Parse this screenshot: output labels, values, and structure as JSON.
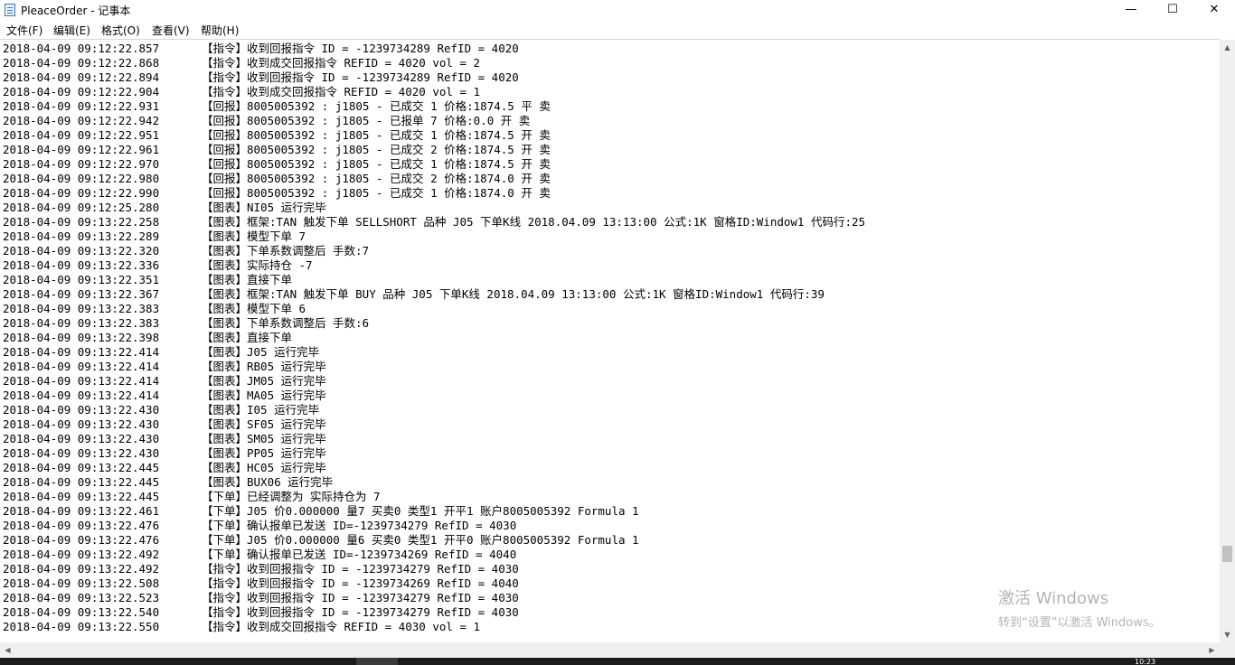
{
  "window": {
    "title": "PleaceOrder - 记事本"
  },
  "controls": {
    "minimize": "—",
    "maximize": "☐",
    "close": "✕"
  },
  "menu": [
    {
      "label": "文件(F)"
    },
    {
      "label": "编辑(E)"
    },
    {
      "label": "格式(O)"
    },
    {
      "label": "查看(V)"
    },
    {
      "label": "帮助(H)"
    }
  ],
  "lines": [
    {
      "ts": "2018-04-09 09:12:22.857",
      "msg": "【指令】收到回报指令 ID = -1239734289 RefID = 4020"
    },
    {
      "ts": "2018-04-09 09:12:22.868",
      "msg": "【指令】收到成交回报指令 REFID = 4020 vol = 2"
    },
    {
      "ts": "2018-04-09 09:12:22.894",
      "msg": "【指令】收到回报指令 ID = -1239734289 RefID = 4020"
    },
    {
      "ts": "2018-04-09 09:12:22.904",
      "msg": "【指令】收到成交回报指令 REFID = 4020 vol = 1"
    },
    {
      "ts": "2018-04-09 09:12:22.931",
      "msg": "【回报】8005005392 : j1805 - 已成交 1 价格:1874.5 平 卖"
    },
    {
      "ts": "2018-04-09 09:12:22.942",
      "msg": "【回报】8005005392 : j1805 - 已报单 7 价格:0.0 开 卖"
    },
    {
      "ts": "2018-04-09 09:12:22.951",
      "msg": "【回报】8005005392 : j1805 - 已成交 1 价格:1874.5 开 卖"
    },
    {
      "ts": "2018-04-09 09:12:22.961",
      "msg": "【回报】8005005392 : j1805 - 已成交 2 价格:1874.5 开 卖"
    },
    {
      "ts": "2018-04-09 09:12:22.970",
      "msg": "【回报】8005005392 : j1805 - 已成交 1 价格:1874.5 开 卖"
    },
    {
      "ts": "2018-04-09 09:12:22.980",
      "msg": "【回报】8005005392 : j1805 - 已成交 2 价格:1874.0 开 卖"
    },
    {
      "ts": "2018-04-09 09:12:22.990",
      "msg": "【回报】8005005392 : j1805 - 已成交 1 价格:1874.0 开 卖"
    },
    {
      "ts": "2018-04-09 09:12:25.280",
      "msg": "【图表】NI05 运行完毕"
    },
    {
      "ts": "2018-04-09 09:13:22.258",
      "msg": "【图表】框架:TAN 触发下单 SELLSHORT 品种 J05 下单K线 2018.04.09 13:13:00 公式:1K 窗格ID:Window1 代码行:25"
    },
    {
      "ts": "2018-04-09 09:13:22.289",
      "msg": "【图表】模型下单 7"
    },
    {
      "ts": "2018-04-09 09:13:22.320",
      "msg": "【图表】下单系数调整后 手数:7"
    },
    {
      "ts": "2018-04-09 09:13:22.336",
      "msg": "【图表】实际持仓 -7"
    },
    {
      "ts": "2018-04-09 09:13:22.351",
      "msg": "【图表】直接下单"
    },
    {
      "ts": "2018-04-09 09:13:22.367",
      "msg": "【图表】框架:TAN 触发下单 BUY 品种 J05 下单K线 2018.04.09 13:13:00 公式:1K 窗格ID:Window1 代码行:39"
    },
    {
      "ts": "2018-04-09 09:13:22.383",
      "msg": "【图表】模型下单 6"
    },
    {
      "ts": "2018-04-09 09:13:22.383",
      "msg": "【图表】下单系数调整后 手数:6"
    },
    {
      "ts": "2018-04-09 09:13:22.398",
      "msg": "【图表】直接下单"
    },
    {
      "ts": "2018-04-09 09:13:22.414",
      "msg": "【图表】J05 运行完毕"
    },
    {
      "ts": "2018-04-09 09:13:22.414",
      "msg": "【图表】RB05 运行完毕"
    },
    {
      "ts": "2018-04-09 09:13:22.414",
      "msg": "【图表】JM05 运行完毕"
    },
    {
      "ts": "2018-04-09 09:13:22.414",
      "msg": "【图表】MA05 运行完毕"
    },
    {
      "ts": "2018-04-09 09:13:22.430",
      "msg": "【图表】I05 运行完毕"
    },
    {
      "ts": "2018-04-09 09:13:22.430",
      "msg": "【图表】SF05 运行完毕"
    },
    {
      "ts": "2018-04-09 09:13:22.430",
      "msg": "【图表】SM05 运行完毕"
    },
    {
      "ts": "2018-04-09 09:13:22.430",
      "msg": "【图表】PP05 运行完毕"
    },
    {
      "ts": "2018-04-09 09:13:22.445",
      "msg": "【图表】HC05 运行完毕"
    },
    {
      "ts": "2018-04-09 09:13:22.445",
      "msg": "【图表】BUX06 运行完毕"
    },
    {
      "ts": "2018-04-09 09:13:22.445",
      "msg": "【下单】已经调整为 实际持仓为 7"
    },
    {
      "ts": "2018-04-09 09:13:22.461",
      "msg": "【下单】J05 价0.000000 量7 买卖0 类型1 开平1 账户8005005392 Formula 1"
    },
    {
      "ts": "2018-04-09 09:13:22.476",
      "msg": "【下单】确认报单已发送 ID=-1239734279 RefID = 4030"
    },
    {
      "ts": "2018-04-09 09:13:22.476",
      "msg": "【下单】J05 价0.000000 量6 买卖0 类型1 开平0 账户8005005392 Formula 1"
    },
    {
      "ts": "2018-04-09 09:13:22.492",
      "msg": "【下单】确认报单已发送 ID=-1239734269 RefID = 4040"
    },
    {
      "ts": "2018-04-09 09:13:22.492",
      "msg": "【指令】收到回报指令 ID = -1239734279 RefID = 4030"
    },
    {
      "ts": "2018-04-09 09:13:22.508",
      "msg": "【指令】收到回报指令 ID = -1239734269 RefID = 4040"
    },
    {
      "ts": "2018-04-09 09:13:22.523",
      "msg": "【指令】收到回报指令 ID = -1239734279 RefID = 4030"
    },
    {
      "ts": "2018-04-09 09:13:22.540",
      "msg": "【指令】收到回报指令 ID = -1239734279 RefID = 4030"
    },
    {
      "ts": "2018-04-09 09:13:22.550",
      "msg": "【指令】收到成交回报指令 REFID = 4030 vol = 1"
    }
  ],
  "watermark": {
    "line1": "激活 Windows",
    "line2": "转到“设置”以激活 Windows。"
  },
  "scroll": {
    "up": "▲",
    "down": "▼",
    "left": "◀",
    "right": "▶"
  },
  "taskbar": {
    "clock": "10:23"
  }
}
